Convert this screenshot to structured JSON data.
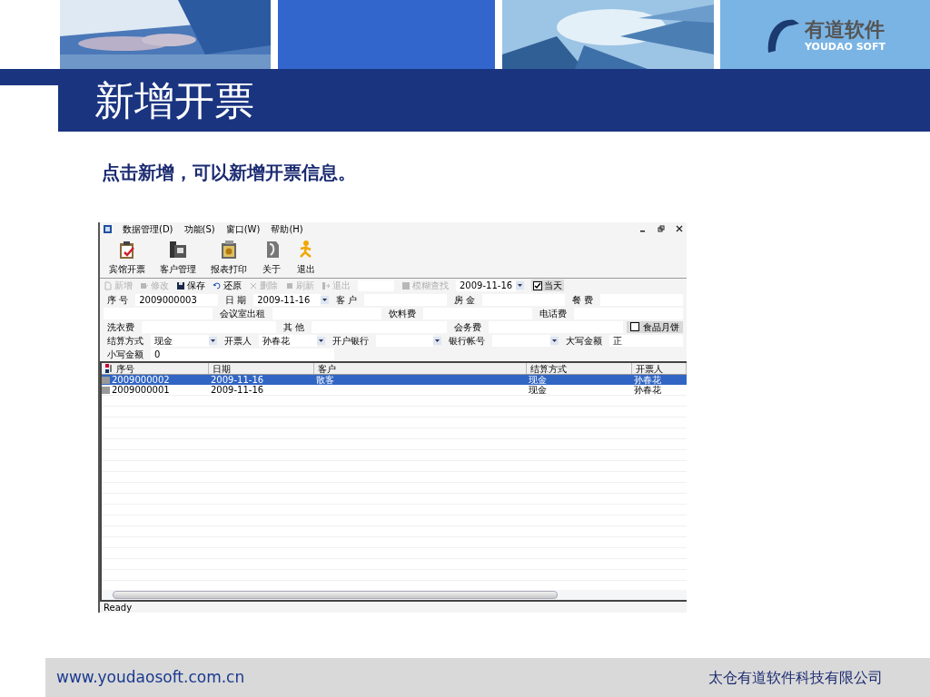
{
  "logo": {
    "name": "有道软件",
    "subtitle": "YOUDAO SOFT"
  },
  "title": "新增开票",
  "subtitle": "点击新增，可以新增开票信息。",
  "app": {
    "menu": [
      "数据管理(D)",
      "功能(S)",
      "窗口(W)",
      "帮助(H)"
    ],
    "toolbar": [
      {
        "label": "宾馆开票",
        "kind": "invoice"
      },
      {
        "label": "客户管理",
        "kind": "clients"
      },
      {
        "label": "报表打印",
        "kind": "report"
      },
      {
        "label": "关于",
        "kind": "about"
      },
      {
        "label": "退出",
        "kind": "exit"
      }
    ],
    "actions": [
      {
        "label": "新增",
        "kind": "new",
        "disabled": true
      },
      {
        "label": "修改",
        "kind": "edit",
        "disabled": true
      },
      {
        "label": "保存",
        "kind": "save",
        "disabled": false
      },
      {
        "label": "还原",
        "kind": "undo",
        "disabled": false
      },
      {
        "label": "删除",
        "kind": "delete",
        "disabled": true
      },
      {
        "label": "刷新",
        "kind": "refresh",
        "disabled": true
      },
      {
        "label": "退出",
        "kind": "exit",
        "disabled": true
      }
    ],
    "search": {
      "label": "模糊查找",
      "disabled": true,
      "date": "2009-11-16",
      "today": {
        "label": "当天",
        "checked": true
      }
    },
    "form": [
      [
        {
          "kind": "label",
          "text": "序 号"
        },
        {
          "kind": "field",
          "value": "2009000003"
        },
        {
          "kind": "label",
          "text": "日 期"
        },
        {
          "kind": "combo",
          "value": "2009-11-16"
        },
        {
          "kind": "label",
          "text": "客 户"
        },
        {
          "kind": "field"
        },
        {
          "kind": "label",
          "text": "房 金"
        },
        {
          "kind": "field"
        },
        {
          "kind": "label",
          "text": "餐 费"
        },
        {
          "kind": "field"
        }
      ],
      [
        {
          "kind": "field"
        },
        {
          "kind": "label",
          "text": "会议室出租"
        },
        {
          "kind": "field"
        },
        {
          "kind": "label",
          "text": "饮料费"
        },
        {
          "kind": "field"
        },
        {
          "kind": "label",
          "text": "电话费"
        },
        {
          "kind": "field"
        }
      ],
      [
        {
          "kind": "label",
          "text": "洗衣费"
        },
        {
          "kind": "field"
        },
        {
          "kind": "label",
          "text": "其 他"
        },
        {
          "kind": "field"
        },
        {
          "kind": "label",
          "text": "会务费"
        },
        {
          "kind": "field"
        },
        {
          "kind": "checkbox",
          "text": "食品月饼",
          "checked": false
        }
      ],
      [
        {
          "kind": "label",
          "text": "结算方式"
        },
        {
          "kind": "combo",
          "value": "现金"
        },
        {
          "kind": "label",
          "text": "开票人"
        },
        {
          "kind": "combo",
          "value": "孙春花"
        },
        {
          "kind": "label",
          "text": "开户银行"
        },
        {
          "kind": "combo"
        },
        {
          "kind": "label",
          "text": "银行帐号"
        },
        {
          "kind": "combo"
        },
        {
          "kind": "label",
          "text": "大写金额"
        },
        {
          "kind": "field",
          "value": "正"
        }
      ],
      [
        {
          "kind": "label",
          "text": "小写金额"
        },
        {
          "kind": "field",
          "value": "0"
        }
      ]
    ],
    "table": {
      "columns": [
        "序号",
        "日期",
        "客户",
        "结算方式",
        "开票人"
      ],
      "rows": [
        {
          "cells": [
            "2009000002",
            "2009-11-16",
            "散客",
            "现金",
            "孙春花"
          ],
          "selected": true
        },
        {
          "cells": [
            "2009000001",
            "2009-11-16",
            "",
            "现金",
            "孙春花"
          ],
          "selected": false
        }
      ]
    },
    "status_bar": "Ready"
  },
  "footer": {
    "url": "www.youdaosoft.com.cn",
    "company": "太仓有道软件科技有限公司"
  }
}
